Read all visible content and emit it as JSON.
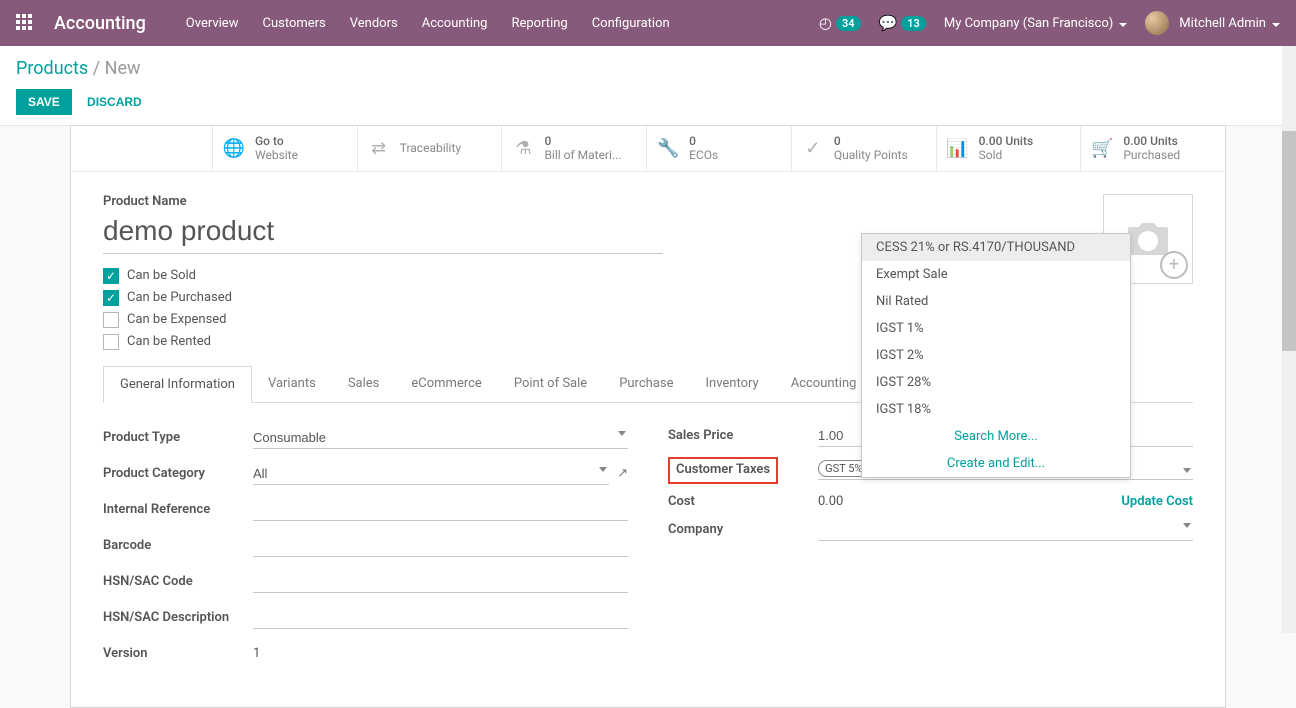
{
  "navbar": {
    "brand": "Accounting",
    "menu": [
      "Overview",
      "Customers",
      "Vendors",
      "Accounting",
      "Reporting",
      "Configuration"
    ],
    "activity_count": "34",
    "msg_count": "13",
    "company": "My Company (San Francisco)",
    "user": "Mitchell Admin"
  },
  "breadcrumb": {
    "root": "Products",
    "current": "New"
  },
  "actions": {
    "save": "SAVE",
    "discard": "DISCARD"
  },
  "stat": {
    "goto1": "Go to",
    "goto2": "Website",
    "trace": "Traceability",
    "bom_n": "0",
    "bom_l": "Bill of Materi...",
    "eco_n": "0",
    "eco_l": "ECOs",
    "qp_n": "0",
    "qp_l": "Quality Points",
    "sold_n": "0.00 Units",
    "sold_l": "Sold",
    "purch_n": "0.00 Units",
    "purch_l": "Purchased"
  },
  "form": {
    "name_label": "Product Name",
    "name_value": "demo product",
    "checks": {
      "sold": "Can be Sold",
      "purchased": "Can be Purchased",
      "expensed": "Can be Expensed",
      "rented": "Can be Rented"
    }
  },
  "tabs": [
    "General Information",
    "Variants",
    "Sales",
    "eCommerce",
    "Point of Sale",
    "Purchase",
    "Inventory",
    "Accounting"
  ],
  "left": {
    "product_type_l": "Product Type",
    "product_type_v": "Consumable",
    "category_l": "Product Category",
    "category_v": "All",
    "intref_l": "Internal Reference",
    "barcode_l": "Barcode",
    "hsn_l": "HSN/SAC Code",
    "hsndesc_l": "HSN/SAC Description",
    "version_l": "Version",
    "version_v": "1"
  },
  "right": {
    "sales_price_l": "Sales Price",
    "sales_price_v": "1.00",
    "cust_tax_l": "Customer Taxes",
    "cust_tax_tag": "GST 5%",
    "cost_l": "Cost",
    "cost_v": "0.00",
    "update_cost": "Update Cost",
    "company_l": "Company"
  },
  "dropdown": {
    "items": [
      "CESS 21% or RS.4170/THOUSAND",
      "Exempt Sale",
      "Nil Rated",
      "IGST 1%",
      "IGST 2%",
      "IGST 28%",
      "IGST 18%"
    ],
    "search_more": "Search More...",
    "create_edit": "Create and Edit..."
  }
}
